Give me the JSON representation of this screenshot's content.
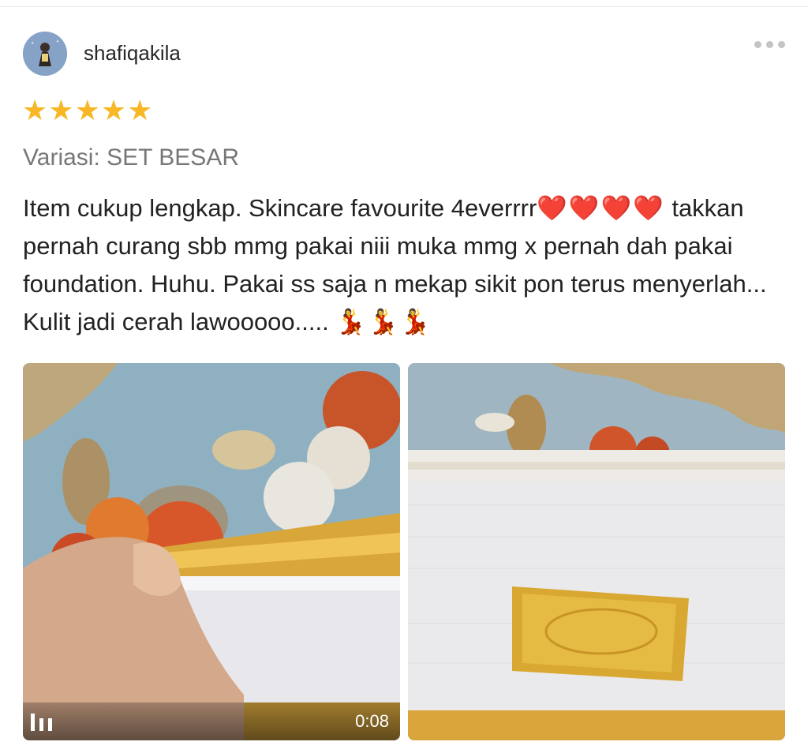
{
  "review": {
    "username": "shafiqakila",
    "rating": 5,
    "stars": [
      "★",
      "★",
      "★",
      "★",
      "★"
    ],
    "variation": "Variasi: SET BESAR",
    "text_part1": "Item cukup lengkap. Skincare favourite 4everrrr",
    "hearts": "❤️❤️❤️❤️",
    "text_part2": " takkan pernah curang sbb mmg pakai niii muka mmg x pernah dah pakai foundation. Huhu. Pakai ss saja n mekap sikit pon terus menyerlah... Kulit jadi cerah lawooooo..... ",
    "dancers": "💃💃💃"
  },
  "media": {
    "video": {
      "duration": "0:08",
      "icon": "video-bars-icon"
    },
    "photo": {
      "icon": "photo"
    }
  },
  "colors": {
    "star": "#f7b726",
    "variation_text": "#777777",
    "body_text": "#222222",
    "more_dots": "#c4c4c4"
  }
}
